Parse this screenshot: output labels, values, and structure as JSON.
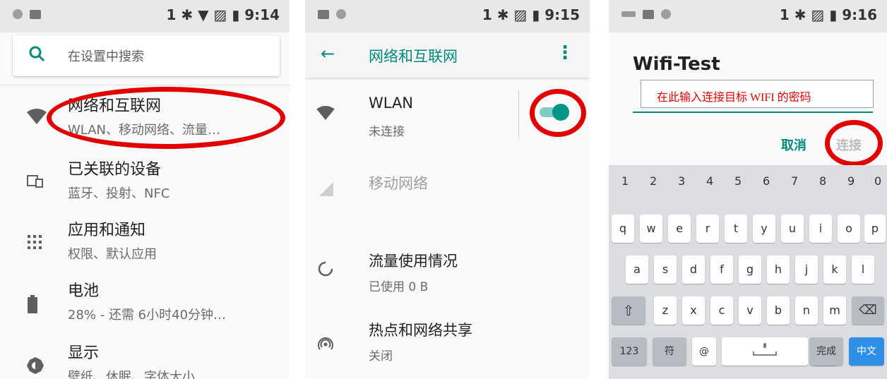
{
  "panel1": {
    "status": {
      "right": "1 ✱ ▼ ▨ ▮ 9:14",
      "time": "9:14"
    },
    "search": {
      "placeholder": "在设置中搜索"
    },
    "items": [
      {
        "title": "网络和互联网",
        "sub": "WLAN、移动网络、流量…",
        "icon": "wifi-icon"
      },
      {
        "title": "已关联的设备",
        "sub": "蓝牙、投射、NFC",
        "icon": "devices-icon"
      },
      {
        "title": "应用和通知",
        "sub": "权限、默认应用",
        "icon": "apps-grid-icon"
      },
      {
        "title": "电池",
        "sub": "28% - 还需 6小时40分钟…",
        "icon": "battery-icon"
      },
      {
        "title": "显示",
        "sub": "壁纸、休眠、字体大小",
        "icon": "brightness-icon"
      }
    ]
  },
  "panel2": {
    "status": {
      "right": "1 ✱ ▨ ▮ 9:15",
      "time": "9:15"
    },
    "appbar": {
      "back": "←",
      "title": "网络和互联网",
      "more": "⋮"
    },
    "wlan": {
      "title": "WLAN",
      "sub": "未连接",
      "enabled": true
    },
    "mobile": {
      "title": "移动网络"
    },
    "data_usage": {
      "title": "流量使用情况",
      "sub": "已使用 0 B"
    },
    "hotspot": {
      "title": "热点和网络共享",
      "sub": "关闭"
    }
  },
  "panel3": {
    "status": {
      "right": "1 ✱ ▨ ▮ 9:16",
      "time": "9:16"
    },
    "dialog": {
      "title": "Wifi-Test",
      "password_hint": "在此输入连接目标 WIFI 的密码",
      "cancel": "取消",
      "connect": "连接"
    },
    "keyboard": {
      "numbers": [
        "1",
        "2",
        "3",
        "4",
        "5",
        "6",
        "7",
        "8",
        "9",
        "0"
      ],
      "row1": [
        "q",
        "w",
        "e",
        "r",
        "t",
        "y",
        "u",
        "i",
        "o",
        "p"
      ],
      "row2": [
        "a",
        "s",
        "d",
        "f",
        "g",
        "h",
        "j",
        "k",
        "l"
      ],
      "row3": [
        "z",
        "x",
        "c",
        "v",
        "b",
        "n",
        "m"
      ],
      "shift": "⇧",
      "backspace": "⌫",
      "bottom": {
        "num": "123",
        "sym": "符",
        "at": "@",
        "dot": ".",
        "done": "完成",
        "lang": "中文"
      }
    }
  },
  "colors": {
    "accent": "#00897b",
    "highlight": "#e00000",
    "enter_key": "#2f8ee6"
  }
}
